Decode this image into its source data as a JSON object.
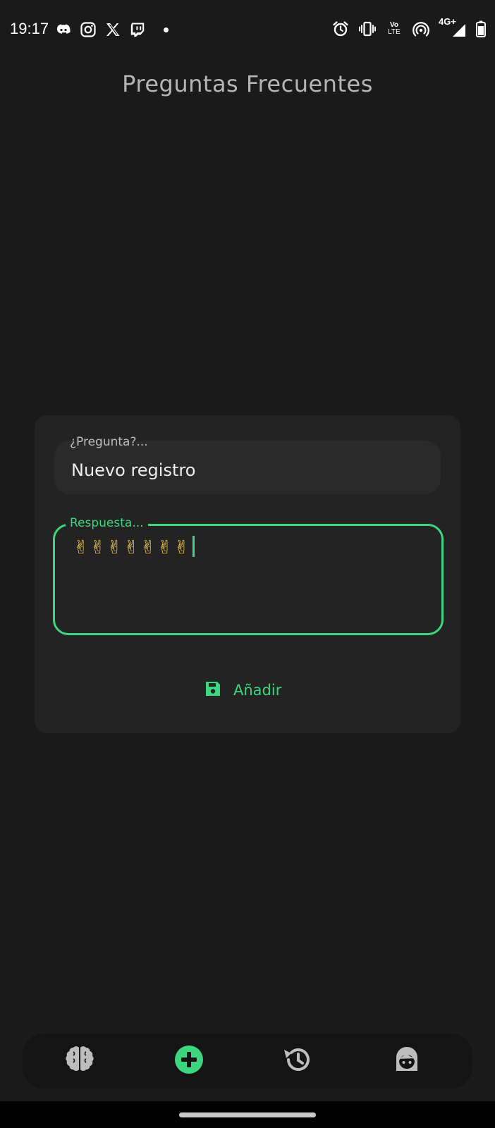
{
  "status_bar": {
    "time": "19:17",
    "left_icons": [
      "discord-icon",
      "instagram-icon",
      "x-icon",
      "twitch-icon",
      "notification-dot-icon"
    ],
    "right_icons": [
      "alarm-icon",
      "vibrate-icon",
      "volte-icon",
      "hotspot-icon",
      "signal-4g-icon",
      "battery-icon"
    ],
    "volte_top": "Vo",
    "volte_bottom": "LTE",
    "network_label": "4G+"
  },
  "header": {
    "title": "Preguntas Frecuentes"
  },
  "form": {
    "question_label": "¿Pregunta?...",
    "question_value": "Nuevo registro",
    "answer_label": "Respuesta...",
    "answer_value": "✌✌✌✌✌✌✌",
    "add_button_label": "Añadir"
  },
  "bottom_nav": {
    "items": [
      {
        "name": "brain-icon"
      },
      {
        "name": "add-circle-icon",
        "active": true
      },
      {
        "name": "history-icon"
      },
      {
        "name": "profile-icon"
      }
    ]
  },
  "colors": {
    "accent": "#3bd67f",
    "background": "#1a1a1a",
    "card": "#232323",
    "icon_inactive": "#bdbdbd"
  }
}
